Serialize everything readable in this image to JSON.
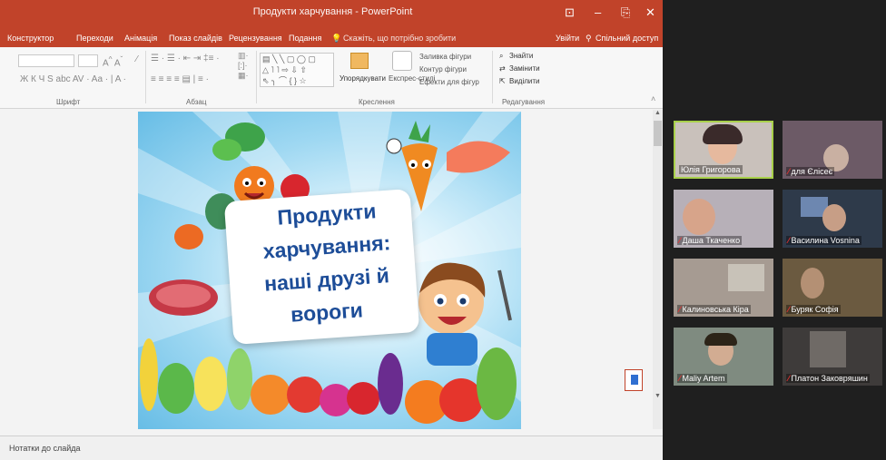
{
  "window": {
    "title": "Продукти харчування - PowerPoint",
    "accent_color": "#c1432a",
    "buttons": [
      "⊡",
      "–",
      "⎘",
      "✕"
    ]
  },
  "ribbon_tabs": [
    "Конструктор",
    "Переходи",
    "Анімація",
    "Показ слайдів",
    "Рецензування",
    "Подання"
  ],
  "search_hint": "Скажіть, що потрібно зробити",
  "sign_in": "Увійти",
  "share": "Спільний доступ",
  "ribbon": {
    "font_group": "Шрифт",
    "paragraph_group": "Абзац",
    "drawing_group": "Креслення",
    "editing_group": "Редагування",
    "arrange": "Упорядкувати",
    "quick_styles": "Експрес-стилі",
    "shape_fill": "Заливка фігури",
    "shape_outline": "Контур фігури",
    "shape_effects": "Ефекти для фігур",
    "find": "Знайти",
    "replace": "Замінити",
    "select": "Виділити"
  },
  "slide": {
    "title_lines": [
      "Продукти",
      "харчування:",
      "наші друзі й",
      "вороги"
    ]
  },
  "notes_placeholder": "Нотатки до слайда",
  "participants": [
    {
      "name": "Юлія Григорова",
      "muted": false,
      "active": true
    },
    {
      "name": "для Єлісеє",
      "muted": true,
      "active": false
    },
    {
      "name": "Даша Ткаченко",
      "muted": true,
      "active": false
    },
    {
      "name": "Василина Vosnina",
      "muted": true,
      "active": false
    },
    {
      "name": "Калиновська Кіра",
      "muted": true,
      "active": false
    },
    {
      "name": "Буряк Софія",
      "muted": true,
      "active": false
    },
    {
      "name": "Maliy Artem",
      "muted": true,
      "active": false
    },
    {
      "name": "Платон Заковряшин",
      "muted": true,
      "active": false
    }
  ]
}
